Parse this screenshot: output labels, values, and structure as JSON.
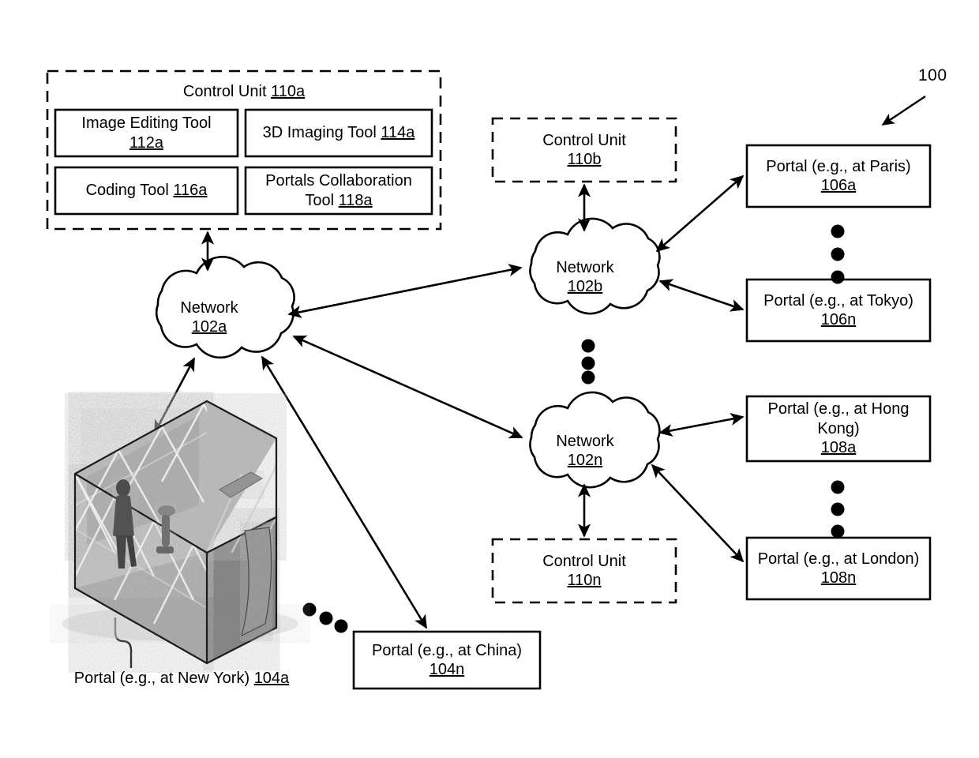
{
  "figure": {
    "number": "100",
    "title_unused": ""
  },
  "control_unit_a": {
    "title": "Control Unit",
    "ref": "110a",
    "tools": [
      {
        "name": "Image Editing Tool",
        "ref": "112a",
        "wrap": true
      },
      {
        "name": "3D Imaging Tool",
        "ref": "114a",
        "wrap": false
      },
      {
        "name": "Coding Tool",
        "ref": "116a",
        "wrap": false
      },
      {
        "name": "Portals Collaboration",
        "name2": "Tool",
        "ref": "118a",
        "wrap": true
      }
    ]
  },
  "control_unit_b": {
    "title": "Control Unit",
    "ref": "110b"
  },
  "control_unit_n": {
    "title": "Control Unit",
    "ref": "110n"
  },
  "networks": [
    {
      "label": "Network",
      "ref": "102a"
    },
    {
      "label": "Network",
      "ref": "102b"
    },
    {
      "label": "Network",
      "ref": "102n"
    }
  ],
  "portals": {
    "new_york": {
      "label": "Portal (e.g., at New York)",
      "ref": "104a"
    },
    "china": {
      "label": "Portal (e.g., at China)",
      "ref": "104n"
    },
    "paris": {
      "label": "Portal (e.g., at Paris)",
      "ref": "106a"
    },
    "tokyo": {
      "label": "Portal (e.g., at Tokyo)",
      "ref": "106n"
    },
    "hong_kong": {
      "label_line1": "Portal (e.g., at Hong",
      "label_line2": "Kong)",
      "ref": "108a"
    },
    "london": {
      "label": "Portal (e.g., at London)",
      "ref": "108n"
    }
  },
  "ellipses": [
    {
      "name": "portals-106-ellipsis",
      "orientation": "vertical"
    },
    {
      "name": "portals-108-ellipsis",
      "orientation": "vertical"
    },
    {
      "name": "networks-ellipsis",
      "orientation": "vertical"
    },
    {
      "name": "portals-104-ellipsis",
      "orientation": "diagonal"
    }
  ],
  "colors": {
    "stroke": "#000000",
    "background": "#ffffff"
  }
}
